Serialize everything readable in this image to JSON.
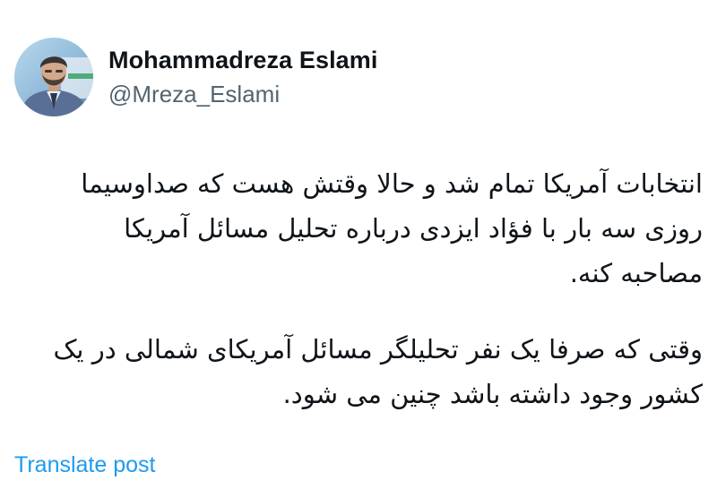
{
  "author": {
    "display_name": "Mohammadreza Eslami",
    "handle": "@Mreza_Eslami",
    "avatar_icon": "profile-photo"
  },
  "post": {
    "paragraphs": [
      {
        "lines": [
          "انتخابات آمریکا تمام شد و حالا وقتش هست که صداوسیما",
          "روزی سه بار با فؤاد ایزدی درباره تحلیل مسائل آمریکا",
          "مصاحبه کنه."
        ]
      },
      {
        "lines": [
          "وقتی که صرفا یک نفر تحلیلگر مسائل آمریکای شمالی در یک",
          "کشور وجود داشته باشد چنین می شود."
        ]
      }
    ]
  },
  "actions": {
    "translate_label": "Translate post"
  },
  "colors": {
    "text": "#0f1419",
    "secondary": "#536471",
    "link": "#1d9bf0",
    "background": "#ffffff"
  }
}
